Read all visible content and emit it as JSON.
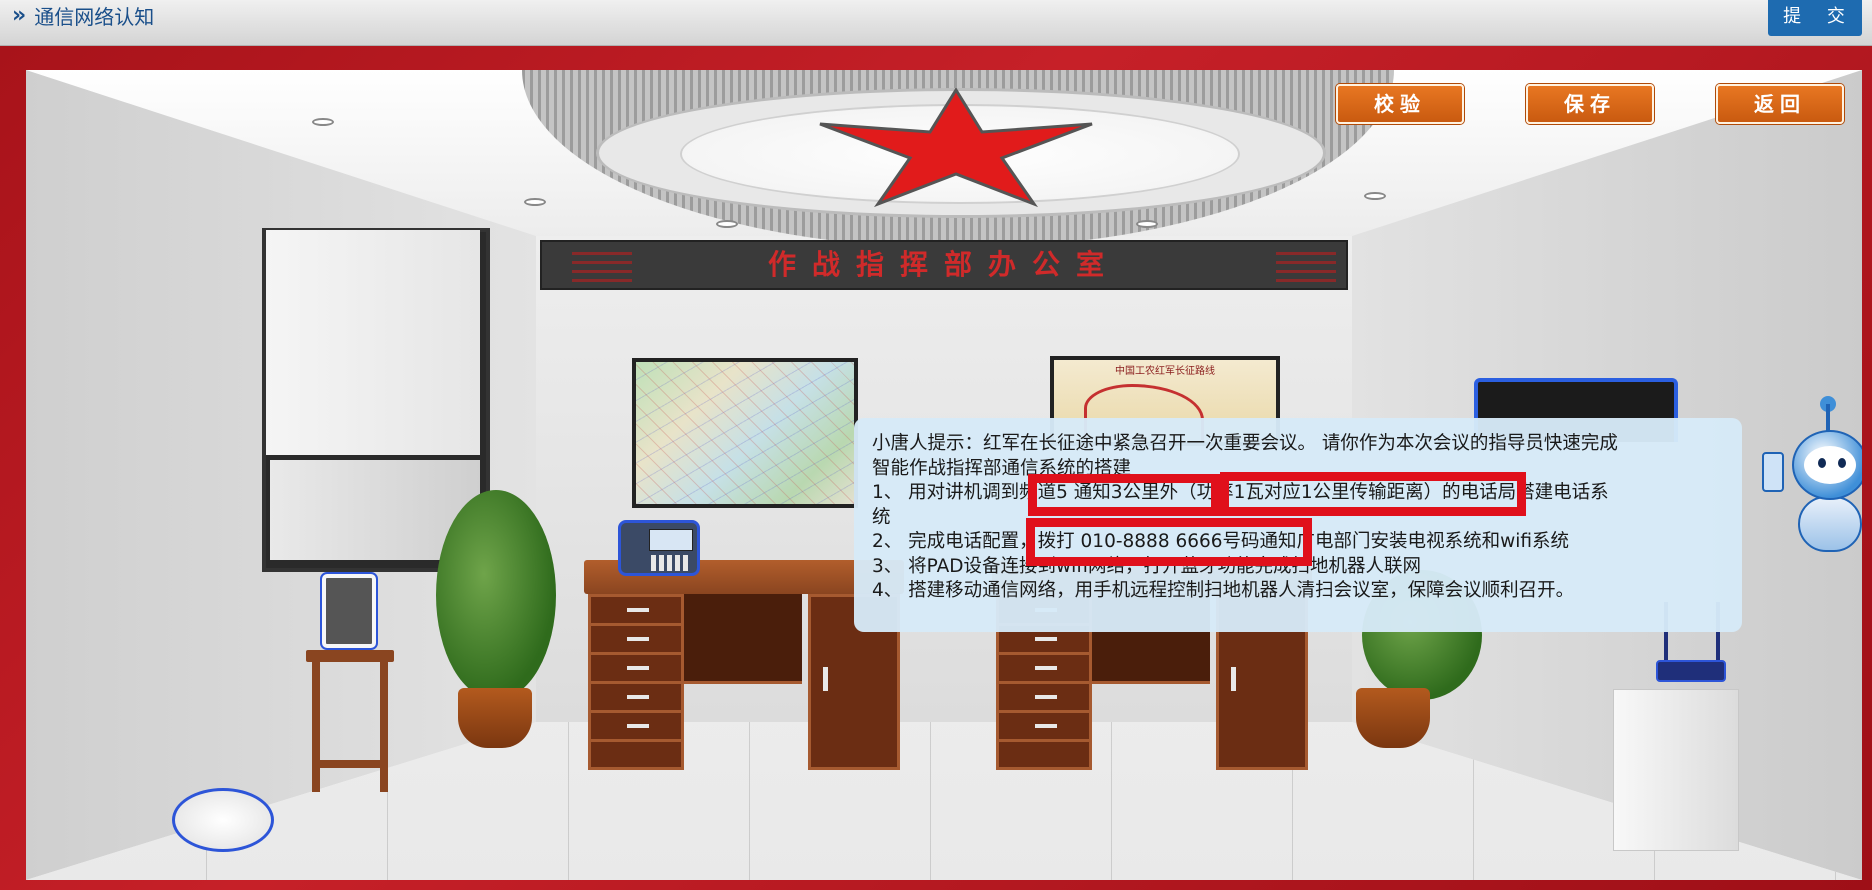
{
  "header": {
    "breadcrumb_icon": "double-chevron-right-icon",
    "title": "通信网络认知",
    "submit_label": "提 交"
  },
  "actions": {
    "verify_label": "校验",
    "save_label": "保存",
    "back_label": "返回"
  },
  "scene": {
    "banner_text": "作战指挥部办公室",
    "map_title": "中国工农红军长征路线"
  },
  "hint": {
    "intro": "小唐人提示：红军在长征途中紧急召开一次重要会议。 请你作为本次会议的指导员快速完成",
    "intro_cont": "智能作战指挥部通信系统的搭建",
    "step1": "1、 用对讲机调到频道5 通知3公里外（功率1瓦对应1公里传输距离）的电话局搭建电话系",
    "step1_cont": "统",
    "step2": "2、 完成电话配置，拨打 010-8888 6666号码通知广电部门安装电视系统和wifi系统",
    "step3": "3、 将PAD设备连接到wifi网络，打开蓝牙功能完成扫地机器人联网",
    "step4": "4、 搭建移动通信网络，用手机远程控制扫地机器人清扫会议室，保障会议顺利召开。"
  },
  "colors": {
    "frame_red": "#c62028",
    "action_orange": "#e87722",
    "submit_blue": "#1e6bb0",
    "highlight_red": "#e0101b",
    "hint_bg": "#d6eaf8"
  }
}
